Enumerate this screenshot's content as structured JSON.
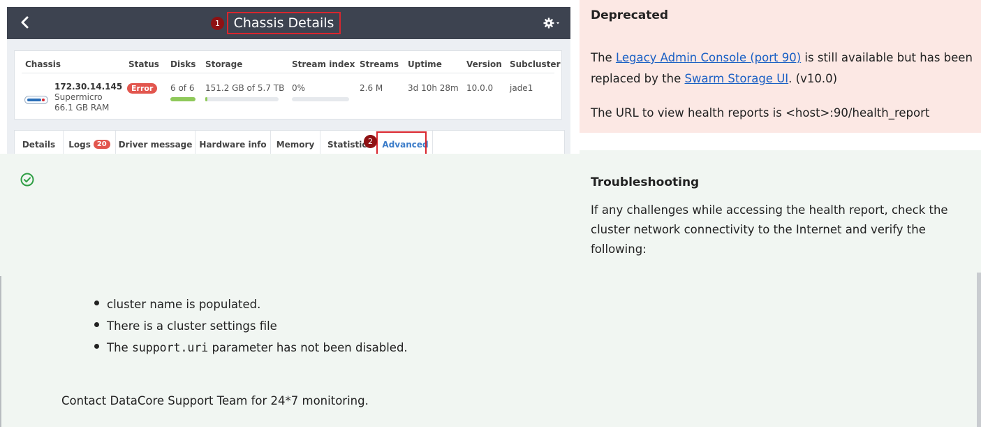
{
  "screenshot": {
    "title": "Chassis Details",
    "markers": [
      "1",
      "2"
    ],
    "table": {
      "headers": [
        "Chassis",
        "Status",
        "Disks",
        "Storage",
        "Stream index",
        "Streams",
        "Uptime",
        "Version",
        "Subcluster"
      ],
      "row": {
        "ip": "172.30.14.145",
        "vendor": "Supermicro",
        "ram": "66.1 GB RAM",
        "status": "Error",
        "disks": "6 of 6",
        "disks_fill": 1.0,
        "storage": "151.2 GB of 5.7 TB",
        "storage_fill": 0.026,
        "stream_index": "0%",
        "stream_index_fill": 0.0,
        "streams": "2.6 M",
        "uptime": "3d 10h 28m",
        "version": "10.0.0",
        "subcluster": "jade1"
      }
    },
    "tabs": [
      {
        "label": "Details"
      },
      {
        "label": "Logs",
        "count": "20"
      },
      {
        "label": "Driver message"
      },
      {
        "label": "Hardware info"
      },
      {
        "label": "Memory"
      },
      {
        "label": "Statistic"
      },
      {
        "label": "Advanced"
      }
    ],
    "icons": {
      "back": "chevron-left-icon",
      "settings": "gear-icon"
    },
    "colors": {
      "header": "#3d4350",
      "highlight": "#d9262e",
      "marker": "#8e1113",
      "error": "#e2564e",
      "accent": "#3b7cc9"
    }
  },
  "deprecated": {
    "title": "Deprecated",
    "text_before": "The ",
    "link1": "Legacy Admin Console (port 90)",
    "text_middle": " is still available but has been replaced by the ",
    "link2": "Swarm Storage UI",
    "text_after": ". (v10.0)",
    "url_note": "The URL to view health reports is <host>:90/health_report",
    "colors": {
      "background": "#fce8e4",
      "link": "#1a5fc4"
    }
  },
  "troubleshooting": {
    "title": "Troubleshooting",
    "body": "If any challenges while accessing the health report, check the cluster network connectivity to the Internet and verify the following:",
    "icon": "check-circle-icon",
    "colors": {
      "background": "#f1f6f2",
      "icon": "#2e9e44"
    }
  },
  "checklist": {
    "items": [
      {
        "text": "cluster name is populated."
      },
      {
        "text": "There is a cluster settings file"
      },
      {
        "prefix": "The ",
        "code": "support.uri",
        "suffix": " parameter has not been disabled."
      }
    ]
  },
  "contact": "Contact DataCore Support Team for 24*7 monitoring."
}
